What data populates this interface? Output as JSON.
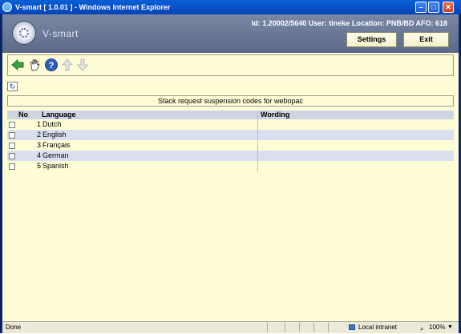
{
  "window": {
    "title": "V-smart [ 1.0.01 ] - Windows Internet Explorer"
  },
  "header": {
    "brand": "V-smart",
    "info": "Id: 1.20002/5640   User: tineke   Location: PNB/BD   AFO: 618",
    "settings_label": "Settings",
    "exit_label": "Exit"
  },
  "toolbar": {
    "icons": [
      "back-arrow-icon",
      "hand-select-icon",
      "help-icon",
      "move-up-icon",
      "move-down-icon"
    ]
  },
  "table": {
    "caption": "Stack request suspension codes for webopac",
    "columns": {
      "no": "No",
      "language": "Language",
      "wording": "Wording"
    },
    "rows": [
      {
        "no": "1",
        "language": "Dutch",
        "wording": ""
      },
      {
        "no": "2",
        "language": "English",
        "wording": ""
      },
      {
        "no": "3",
        "language": "Français",
        "wording": ""
      },
      {
        "no": "4",
        "language": "German",
        "wording": ""
      },
      {
        "no": "5",
        "language": "Spanish",
        "wording": ""
      }
    ]
  },
  "statusbar": {
    "status": "Done",
    "zone": "Local intranet",
    "zoom": "100%"
  }
}
